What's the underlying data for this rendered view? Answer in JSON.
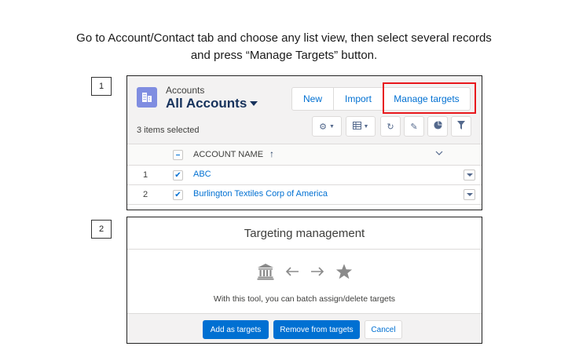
{
  "instructions": {
    "line1": "Go to Account/Contact tab and choose any list view, then select several records",
    "line2": "and press “Manage Targets” button."
  },
  "step1": {
    "number": "1"
  },
  "step2": {
    "number": "2"
  },
  "list_view": {
    "object_label": "Accounts",
    "view_name": "All Accounts",
    "object_icon": "accounts-icon",
    "buttons": {
      "new": "New",
      "import": "Import",
      "manage_targets": "Manage targets"
    },
    "highlight_color": "#e8171c",
    "selected_text": "3 items selected",
    "toolbar_icons": [
      "gear-icon",
      "table-icon",
      "refresh-icon",
      "pencil-icon",
      "pie-chart-icon",
      "filter-icon"
    ],
    "column_header": "ACCOUNT NAME",
    "sort_icon": "arrow-up-icon",
    "rows": [
      {
        "num": "1",
        "name": "ABC",
        "checked": true
      },
      {
        "num": "2",
        "name": "Burlington Textiles Corp of America",
        "checked": true
      }
    ]
  },
  "modal": {
    "title": "Targeting management",
    "icons": [
      "bank-icon",
      "arrow-left-icon",
      "arrow-right-icon",
      "star-icon"
    ],
    "description": "With this tool, you can batch assign/delete targets",
    "buttons": {
      "add": "Add as targets",
      "remove": "Remove from targets",
      "cancel": "Cancel"
    },
    "brand_color": "#0070d2"
  }
}
